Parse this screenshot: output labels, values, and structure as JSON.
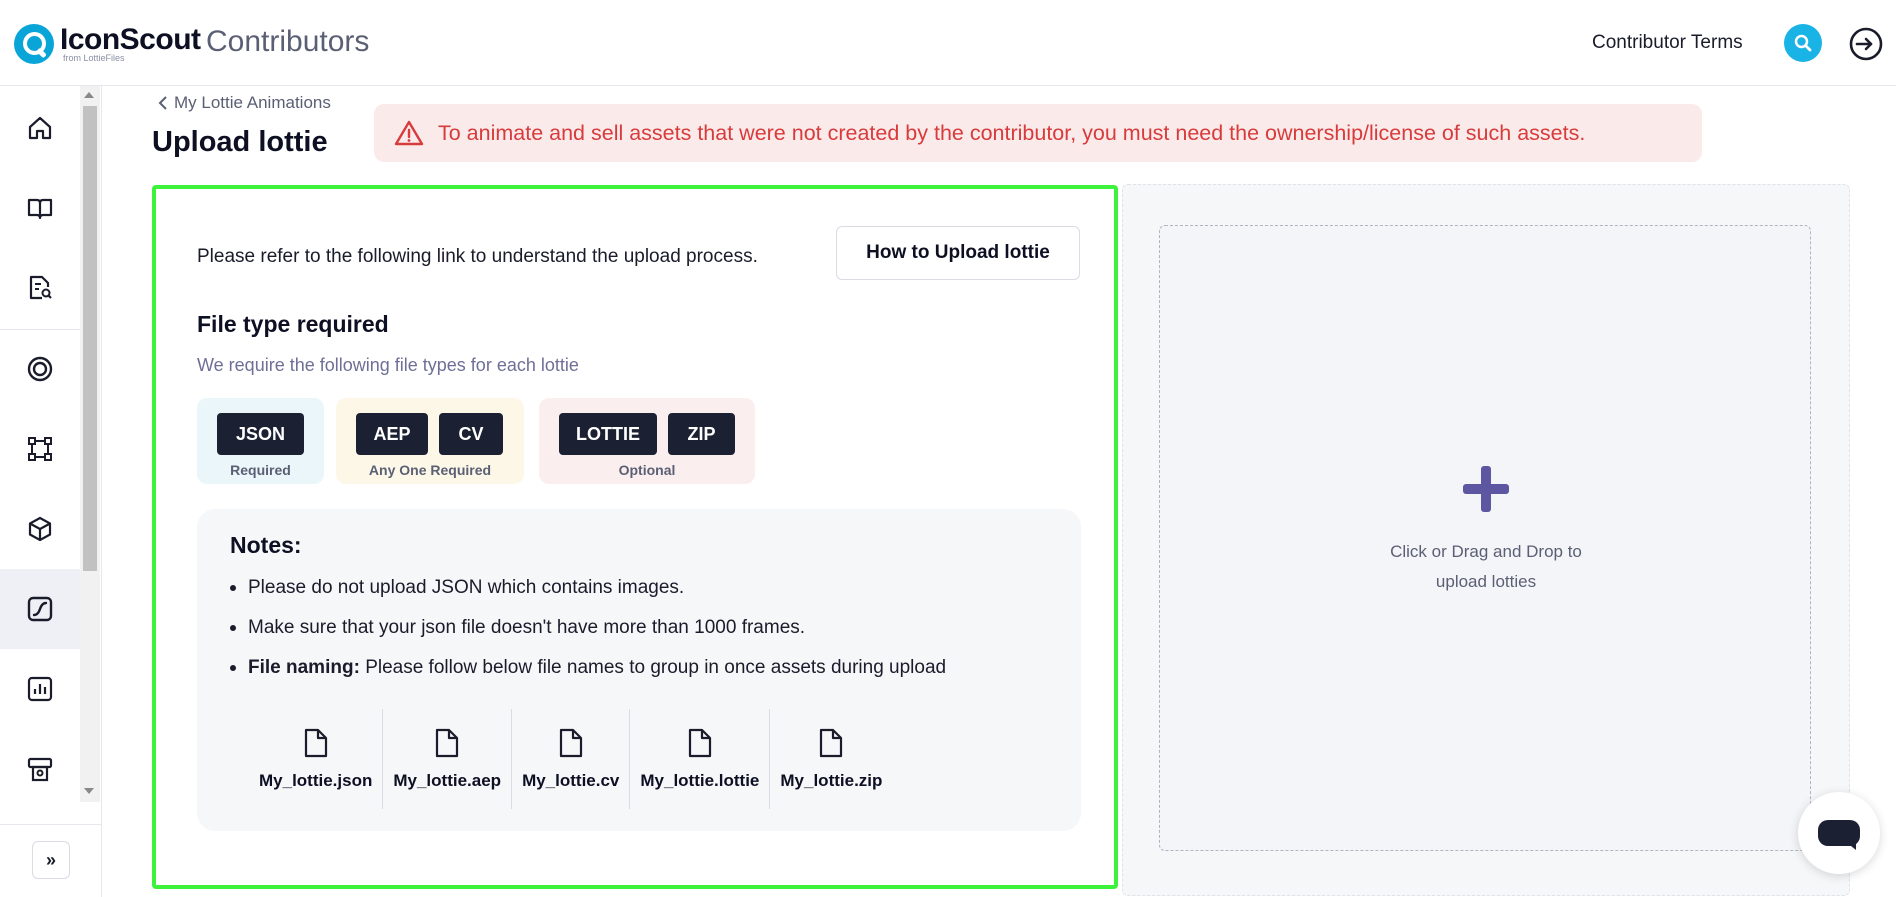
{
  "header": {
    "brand_name": "IconScout",
    "brand_sub": "from LottieFiles",
    "app_title": "Contributors",
    "terms_link": "Contributor Terms",
    "accent_color": "#19b3e6"
  },
  "sidebar": {
    "items": [
      {
        "icon": "home-icon"
      },
      {
        "icon": "book-icon"
      },
      {
        "icon": "document-search-icon"
      },
      {
        "icon": "target-icon"
      },
      {
        "icon": "vector-icon"
      },
      {
        "icon": "cube-icon"
      },
      {
        "icon": "animation-icon",
        "active": true
      },
      {
        "icon": "chart-icon"
      },
      {
        "icon": "payout-icon"
      }
    ],
    "expand_label": "»"
  },
  "main": {
    "back_link": "My Lottie Animations",
    "page_title": "Upload lottie",
    "warning": "To animate and sell assets that were not created by the contributor, you must need the ownership/license of such assets.",
    "refer_text": "Please refer to the following link to understand the upload process.",
    "howto_button": "How to Upload lottie",
    "file_type_heading": "File type required",
    "file_type_sub": "We require the following file types for each lottie",
    "groups": [
      {
        "chips": [
          "JSON"
        ],
        "label": "Required"
      },
      {
        "chips": [
          "AEP",
          "CV"
        ],
        "label": "Any One Required"
      },
      {
        "chips": [
          "LOTTIE",
          "ZIP"
        ],
        "label": "Optional"
      }
    ],
    "notes": {
      "title": "Notes:",
      "items": [
        "Please do not upload JSON which contains images.",
        "Make sure that your json file doesn't have more than 1000 frames.",
        "Please follow below file names to group in once assets during upload"
      ],
      "item3_bold": "File naming:",
      "files": [
        "My_lottie.json",
        "My_lottie.aep",
        "My_lottie.cv",
        "My_lottie.lottie",
        "My_lottie.zip"
      ]
    },
    "dropzone": {
      "line1": "Click or Drag and Drop to",
      "line2": "upload lotties"
    }
  }
}
